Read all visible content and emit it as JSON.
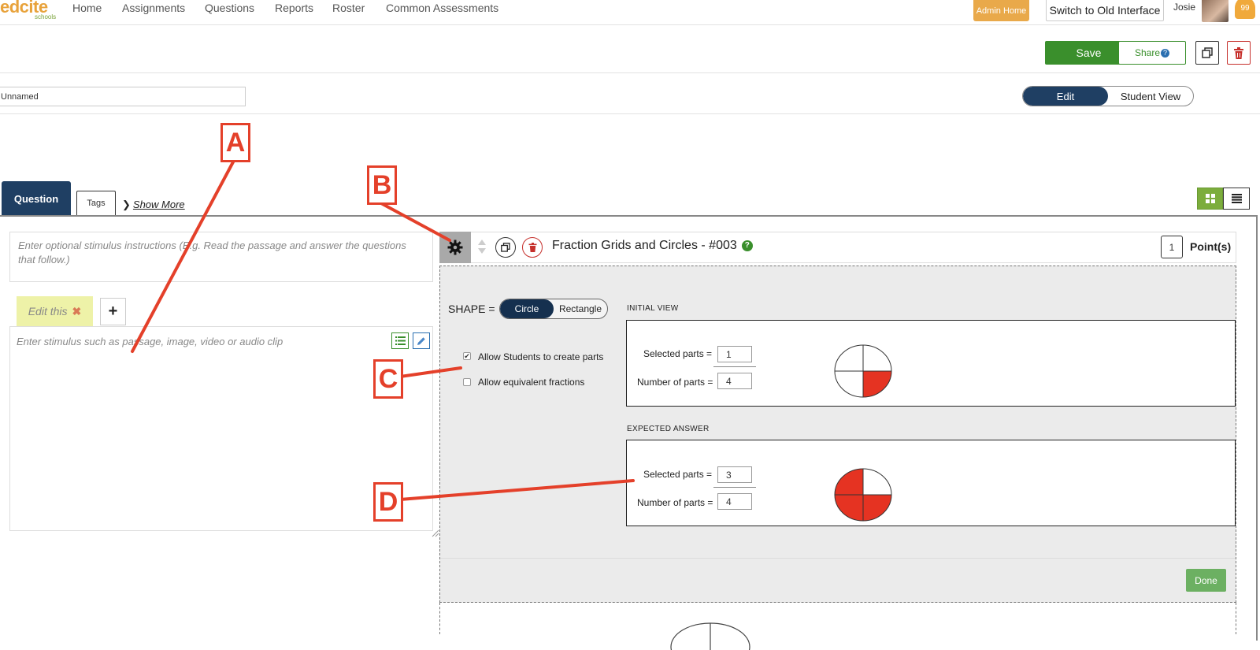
{
  "nav": {
    "logo": "edcite",
    "logo_sub": "schools",
    "links": [
      "Home",
      "Assignments",
      "Questions",
      "Reports",
      "Roster",
      "Common Assessments"
    ],
    "admin_home": "Admin Home",
    "switch_old": "Switch to Old Interface",
    "user": "Josie",
    "notifications": "99"
  },
  "toolbar": {
    "save": "Save",
    "share": "Share",
    "share_help": "?"
  },
  "assessment": {
    "name_value": "Unnamed"
  },
  "view_toggle": {
    "edit": "Edit",
    "student_view": "Student View"
  },
  "tabs": {
    "question": "Question",
    "tags": "Tags",
    "show_more": "Show More"
  },
  "stimulus": {
    "instructions_placeholder": "Enter optional stimulus instructions (E.g. Read the passage and answer the questions that follow.)",
    "edit_tab": "Edit this",
    "edit_tab_close": "✖",
    "add": "+",
    "body_placeholder": "Enter stimulus such as passage, image, video or audio clip"
  },
  "question": {
    "title": "Fraction Grids and Circles - #003",
    "help": "?",
    "points_value": "1",
    "points_label": "Point(s)",
    "shape_label": "SHAPE =",
    "shape_options": [
      "Circle",
      "Rectangle"
    ],
    "shape_selected": "Circle",
    "options": [
      {
        "label": "Allow Students to create parts",
        "checked": true
      },
      {
        "label": "Allow equivalent fractions",
        "checked": false
      }
    ],
    "initial_view": {
      "heading": "INITIAL VIEW",
      "selected_label": "Selected parts =",
      "selected_value": "1",
      "number_label": "Number of parts =",
      "number_value": "4",
      "filled_fraction": 0.25
    },
    "expected_answer": {
      "heading": "EXPECTED ANSWER",
      "selected_label": "Selected parts =",
      "selected_value": "3",
      "number_label": "Number of parts =",
      "number_value": "4",
      "filled_fraction": 0.75
    },
    "done": "Done"
  },
  "annotations": [
    "A",
    "B",
    "C",
    "D"
  ],
  "colors": {
    "brand_navy": "#1f3f63",
    "save_green": "#3a8f2c",
    "fill_red": "#e53322",
    "annotation_red": "#e4402a",
    "admin_orange": "#e9a94a"
  }
}
